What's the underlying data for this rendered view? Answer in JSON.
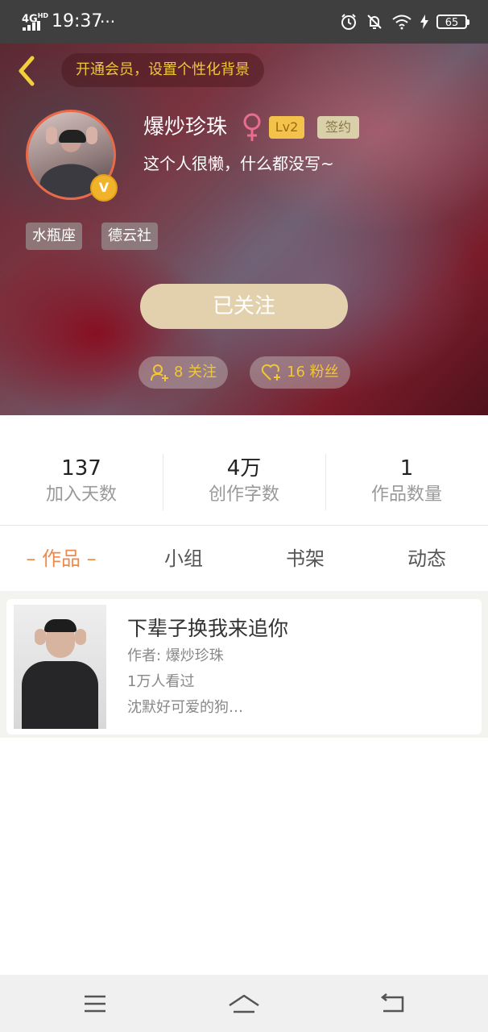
{
  "status_bar": {
    "network": "4G",
    "network_sup": "HD",
    "time": "19:37",
    "more": "···",
    "battery": "65"
  },
  "header": {
    "member_banner": "开通会员，设置个性化背景",
    "username": "爆炒珍珠",
    "level": "Lv2",
    "signed": "签约",
    "bio": "这个人很懒，什么都没写~",
    "verified_badge": "V",
    "tags": [
      "水瓶座",
      "德云社"
    ],
    "follow_button": "已关注",
    "following": "8 关注",
    "fans": "16 粉丝"
  },
  "stats": [
    {
      "value": "137",
      "label": "加入天数"
    },
    {
      "value": "4万",
      "label": "创作字数"
    },
    {
      "value": "1",
      "label": "作品数量"
    }
  ],
  "tabs": [
    {
      "label": "作品",
      "active": true,
      "decor_left": "–",
      "decor_right": "–"
    },
    {
      "label": "小组"
    },
    {
      "label": "书架"
    },
    {
      "label": "动态"
    }
  ],
  "works": [
    {
      "title": "下辈子换我来追你",
      "author": "作者: 爆炒珍珠",
      "views": "1万人看过",
      "summary": "沈默好可爱的狗…"
    }
  ],
  "colors": {
    "accent": "#ec8a4a",
    "gold": "#f0c63a",
    "follow_btn": "#e3d1ad"
  },
  "icons": {
    "back": "chevron-left-icon",
    "female": "female-icon",
    "following": "person-add-icon",
    "fans": "heart-add-icon",
    "nav_menu": "menu-icon",
    "nav_home": "home-icon",
    "nav_back": "back-icon"
  }
}
